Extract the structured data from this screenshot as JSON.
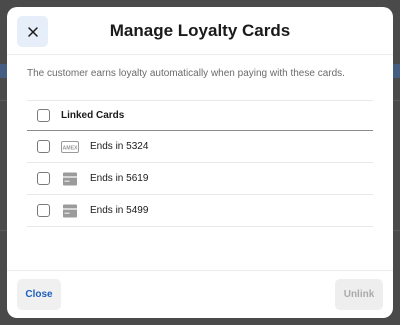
{
  "modal": {
    "title": "Manage Loyalty Cards",
    "close_icon": "close-icon",
    "description": "The customer earns loyalty automatically when paying with these cards."
  },
  "table": {
    "header_label": "Linked Cards",
    "rows": [
      {
        "icon": "amex-card-icon",
        "label": "Ends in 5324",
        "checked": false
      },
      {
        "icon": "generic-card-icon",
        "label": "Ends in 5619",
        "checked": false
      },
      {
        "icon": "generic-card-icon",
        "label": "Ends in 5499",
        "checked": false
      }
    ]
  },
  "footer": {
    "close_label": "Close",
    "unlink_label": "Unlink",
    "unlink_disabled": true
  },
  "colors": {
    "accent": "#1f5fbf",
    "close_icon_bg": "#e6eef9",
    "disabled_text": "#ababab"
  }
}
